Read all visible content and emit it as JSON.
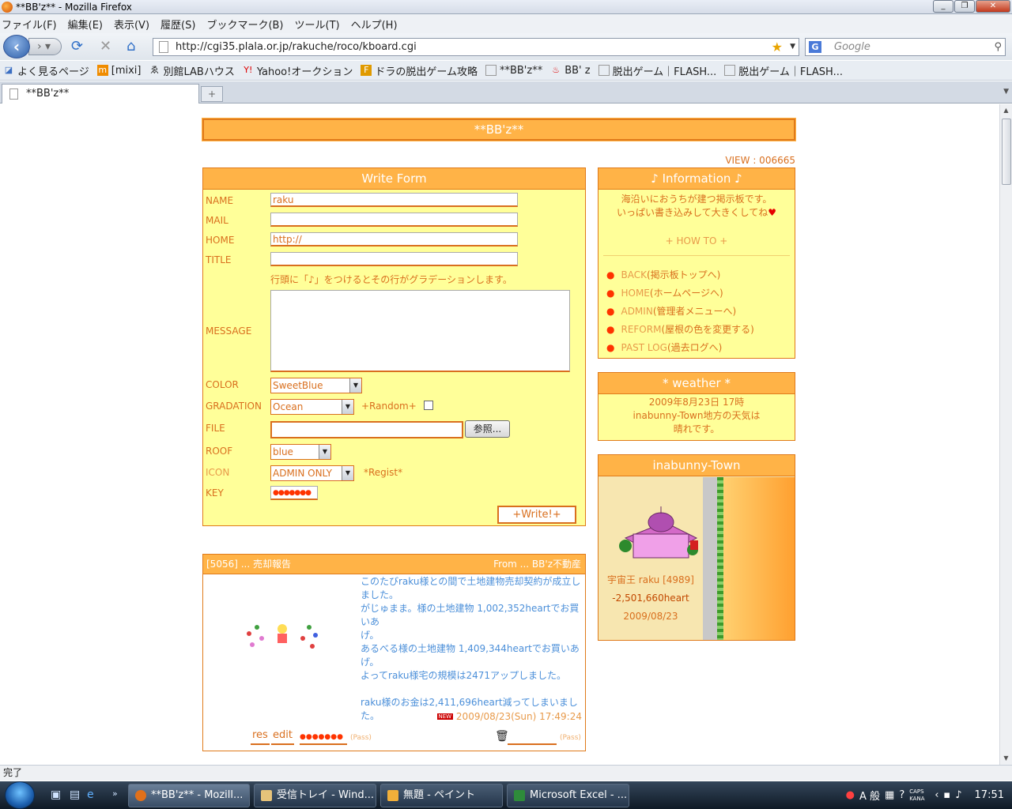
{
  "window": {
    "title": "**BB'z** - Mozilla Firefox",
    "buttons": [
      "_",
      "❐",
      "✕"
    ]
  },
  "menu": [
    "ファイル(F)",
    "編集(E)",
    "表示(V)",
    "履歴(S)",
    "ブックマーク(B)",
    "ツール(T)",
    "ヘルプ(H)"
  ],
  "nav": {
    "url": "http://cgi35.plala.or.jp/rakuche/roco/kboard.cgi",
    "search_placeholder": "Google",
    "search_engine": "G"
  },
  "bookmarks": [
    "よく見るページ",
    "[mixi]",
    "別館LABハウス",
    "Yahoo!オークション",
    "ドラの脱出ゲーム攻略",
    "**BB'z**",
    "BB' z",
    "脱出ゲーム｜FLASH...",
    "脱出ゲーム｜FLASH..."
  ],
  "tab": {
    "title": "**BB'z**",
    "new_tab": "+"
  },
  "page": {
    "title": "**BB'z**",
    "view": "VIEW : 006665",
    "form": {
      "header": "Write Form",
      "name_label": "NAME",
      "name_value": "raku",
      "mail_label": "MAIL",
      "mail_value": "",
      "home_label": "HOME",
      "home_value": "http://",
      "title_label": "TITLE",
      "title_value": "",
      "hint": "行頭に「♪」をつけるとその行がグラデーションします。",
      "message_label": "MESSAGE",
      "color_label": "COLOR",
      "color_value": "SweetBlue",
      "gradation_label": "GRADATION",
      "gradation_value": "Ocean",
      "random_label": "+Random+",
      "file_label": "FILE",
      "browse_label": "参照...",
      "roof_label": "ROOF",
      "roof_value": "blue",
      "icon_label": "ICON",
      "icon_value": "ADMIN ONLY",
      "regist_label": "*Regist*",
      "key_label": "KEY",
      "key_value": "●●●●●●●",
      "write_label": "+Write!+"
    },
    "info": {
      "header": "♪ Information ♪",
      "desc1": "海沿いにおうちが建つ掲示板です。",
      "desc2": "いっぱい書き込みして大きくしてね",
      "heart": "♥",
      "howto": "+ HOW TO +",
      "links": [
        {
          "k": "BACK",
          "v": "(掲示板トップへ)"
        },
        {
          "k": "HOME",
          "v": "(ホームページへ)"
        },
        {
          "k": "ADMIN",
          "v": "(管理者メニューへ)"
        },
        {
          "k": "REFORM",
          "v": "(屋根の色を変更する)"
        },
        {
          "k": "PAST LOG",
          "v": "(過去ログへ)"
        }
      ]
    },
    "weather": {
      "header": "* weather *",
      "line1": "2009年8月23日 17時",
      "line2": "inabunny-Town地方の天気は",
      "line3": "晴れです。"
    },
    "town": {
      "header": "inabunny-Town",
      "owner": "宇宙王 raku [4989]",
      "money": "-2,501,660heart",
      "date": "2009/08/23"
    },
    "post": {
      "title": "[5056] ... 売却報告",
      "from": "From ... BB'z不動産",
      "lines": [
        "このたびraku様との間で土地建物売却契約が成立し",
        "ました。",
        "がじゅまま。様の土地建物 1,002,352heartでお買いあ",
        "げ。",
        "あるべる様の土地建物 1,409,344heartでお買いあ",
        "げ。",
        "よってraku様宅の規模は2471アップしました。",
        "",
        "raku様のお金は2,411,696heart減ってしまいました。"
      ],
      "new_badge": "NEW",
      "date": "2009/08/23(Sun) 17:49:24",
      "res": "res",
      "edit": "edit",
      "pass_dots": "●●●●●●●",
      "pass_hint": "(Pass)",
      "pass_hint2": "(Pass)"
    }
  },
  "status": "完了",
  "taskbar": {
    "tasks": [
      "**BB'z** - Mozill...",
      "受信トレイ - Wind...",
      "無題 - ペイント",
      "Microsoft Excel - ..."
    ],
    "ime": "A 般",
    "caps": "CAPS KANA",
    "clock": "17:51"
  }
}
